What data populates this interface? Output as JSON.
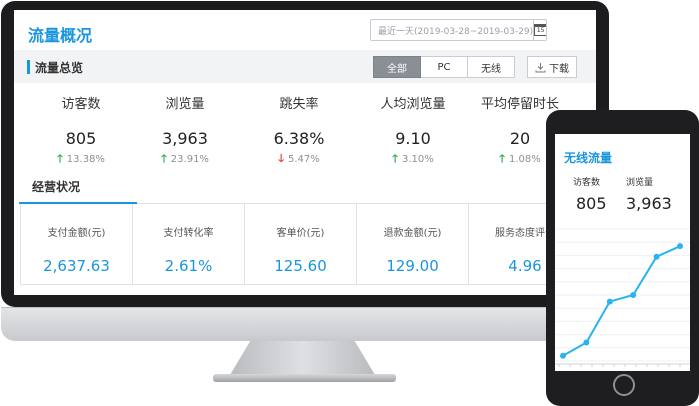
{
  "desktop": {
    "title": "流量概况",
    "date_range": "最近一天(2019-03-28~2019-03-29)",
    "calendar_icon_text": "15",
    "section_title": "流量总览",
    "filters": [
      "全部",
      "PC",
      "无线"
    ],
    "active_filter": "全部",
    "download_label": "下载",
    "metrics": [
      {
        "label": "访客数",
        "value": "805",
        "change": "13.38%",
        "direction": "up"
      },
      {
        "label": "浏览量",
        "value": "3,963",
        "change": "23.91%",
        "direction": "up"
      },
      {
        "label": "跳失率",
        "value": "6.38%",
        "change": "5.47%",
        "direction": "down"
      },
      {
        "label": "人均浏览量",
        "value": "9.10",
        "change": "3.10%",
        "direction": "up"
      },
      {
        "label": "平均停留时长",
        "value": "20",
        "change": "1.08%",
        "direction": "up"
      }
    ],
    "business_title": "经营状况",
    "business": [
      {
        "label": "支付金额(元)",
        "value": "2,637.63"
      },
      {
        "label": "支付转化率",
        "value": "2.61%"
      },
      {
        "label": "客单价(元)",
        "value": "125.60"
      },
      {
        "label": "退款金额(元)",
        "value": "129.00"
      },
      {
        "label": "服务态度评分",
        "value": "4.96"
      }
    ]
  },
  "mobile": {
    "title": "无线流量",
    "stats": [
      {
        "label": "访客数",
        "value": "805"
      },
      {
        "label": "浏览量",
        "value": "3,963"
      }
    ],
    "chart_data": {
      "type": "line",
      "values": [
        0.4,
        1.4,
        4.5,
        5.0,
        7.9,
        8.7
      ],
      "color": "#29b3ef"
    }
  },
  "colors": {
    "accent": "#1a95df",
    "up": "#2aa84a",
    "down": "#e23b3b"
  }
}
